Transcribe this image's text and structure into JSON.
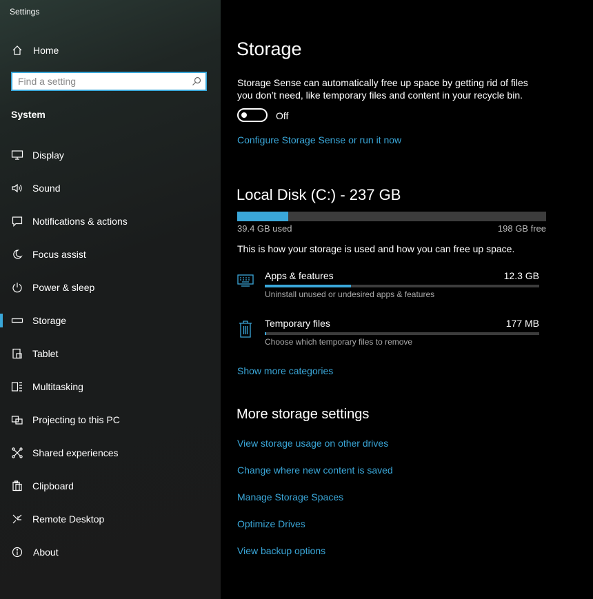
{
  "app": {
    "title": "Settings"
  },
  "sidebar": {
    "home_label": "Home",
    "search_placeholder": "Find a setting",
    "section_label": "System",
    "items": [
      {
        "label": "Display",
        "icon": "display-icon"
      },
      {
        "label": "Sound",
        "icon": "sound-icon"
      },
      {
        "label": "Notifications & actions",
        "icon": "notifications-icon"
      },
      {
        "label": "Focus assist",
        "icon": "moon-icon"
      },
      {
        "label": "Power & sleep",
        "icon": "power-icon"
      },
      {
        "label": "Storage",
        "icon": "storage-icon",
        "active": true
      },
      {
        "label": "Tablet",
        "icon": "tablet-icon"
      },
      {
        "label": "Multitasking",
        "icon": "multitasking-icon"
      },
      {
        "label": "Projecting to this PC",
        "icon": "projecting-icon"
      },
      {
        "label": "Shared experiences",
        "icon": "shared-experiences-icon"
      },
      {
        "label": "Clipboard",
        "icon": "clipboard-icon"
      },
      {
        "label": "Remote Desktop",
        "icon": "remote-desktop-icon"
      },
      {
        "label": "About",
        "icon": "info-icon"
      }
    ]
  },
  "main": {
    "title": "Storage",
    "storage_sense_description": "Storage Sense can automatically free up space by getting rid of files you don’t need, like temporary files and content in your recycle bin.",
    "toggle_state": "Off",
    "configure_link": "Configure Storage Sense or run it now",
    "disk": {
      "title": "Local Disk (C:) - 237 GB",
      "used_label": "39.4 GB used",
      "free_label": "198 GB free",
      "used_fraction": 0.166
    },
    "usage_description": "This is how your storage is used and how you can free up space.",
    "categories": [
      {
        "name": "Apps & features",
        "size": "12.3 GB",
        "description": "Uninstall unused or undesired apps & features",
        "fraction": 0.315,
        "icon": "apps-features-icon"
      },
      {
        "name": "Temporary files",
        "size": "177 MB",
        "description": "Choose which temporary files to remove",
        "fraction": 0.005,
        "icon": "trash-icon"
      }
    ],
    "show_more_link": "Show more categories",
    "more_settings_title": "More storage settings",
    "more_links": [
      "View storage usage on other drives",
      "Change where new content is saved",
      "Manage Storage Spaces",
      "Optimize Drives",
      "View backup options"
    ]
  },
  "colors": {
    "accent": "#3aa7d9",
    "track": "#3c3c3c"
  }
}
